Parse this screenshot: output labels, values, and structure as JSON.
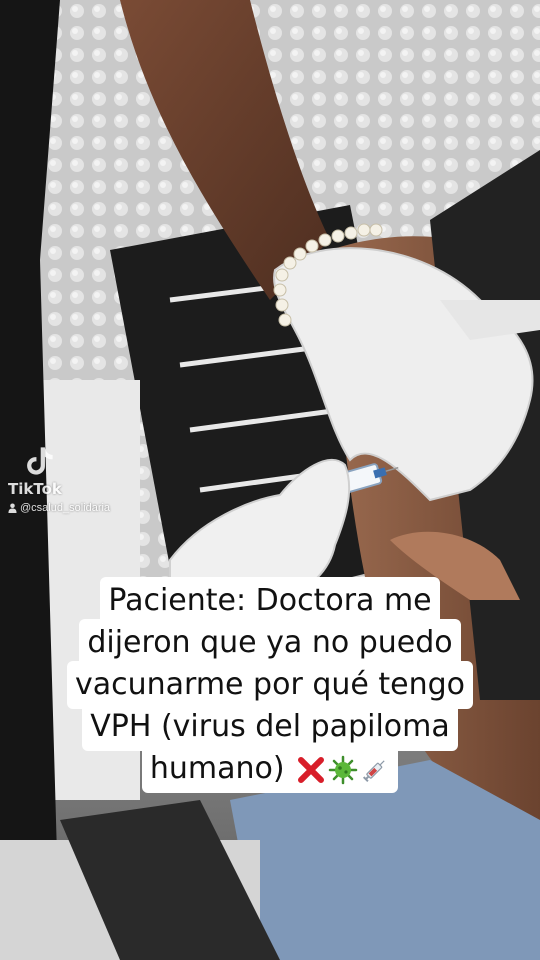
{
  "watermark": {
    "brand": "TikTok",
    "username": "@csalud_solidaria"
  },
  "caption": {
    "lines": [
      "Paciente: Doctora me",
      "dijeron que ya no puedo",
      "vacunarme por qué tengo",
      "VPH (virus del papiloma",
      "humano)"
    ],
    "emojis": [
      "cross-mark-icon",
      "virus-icon",
      "syringe-icon"
    ]
  }
}
